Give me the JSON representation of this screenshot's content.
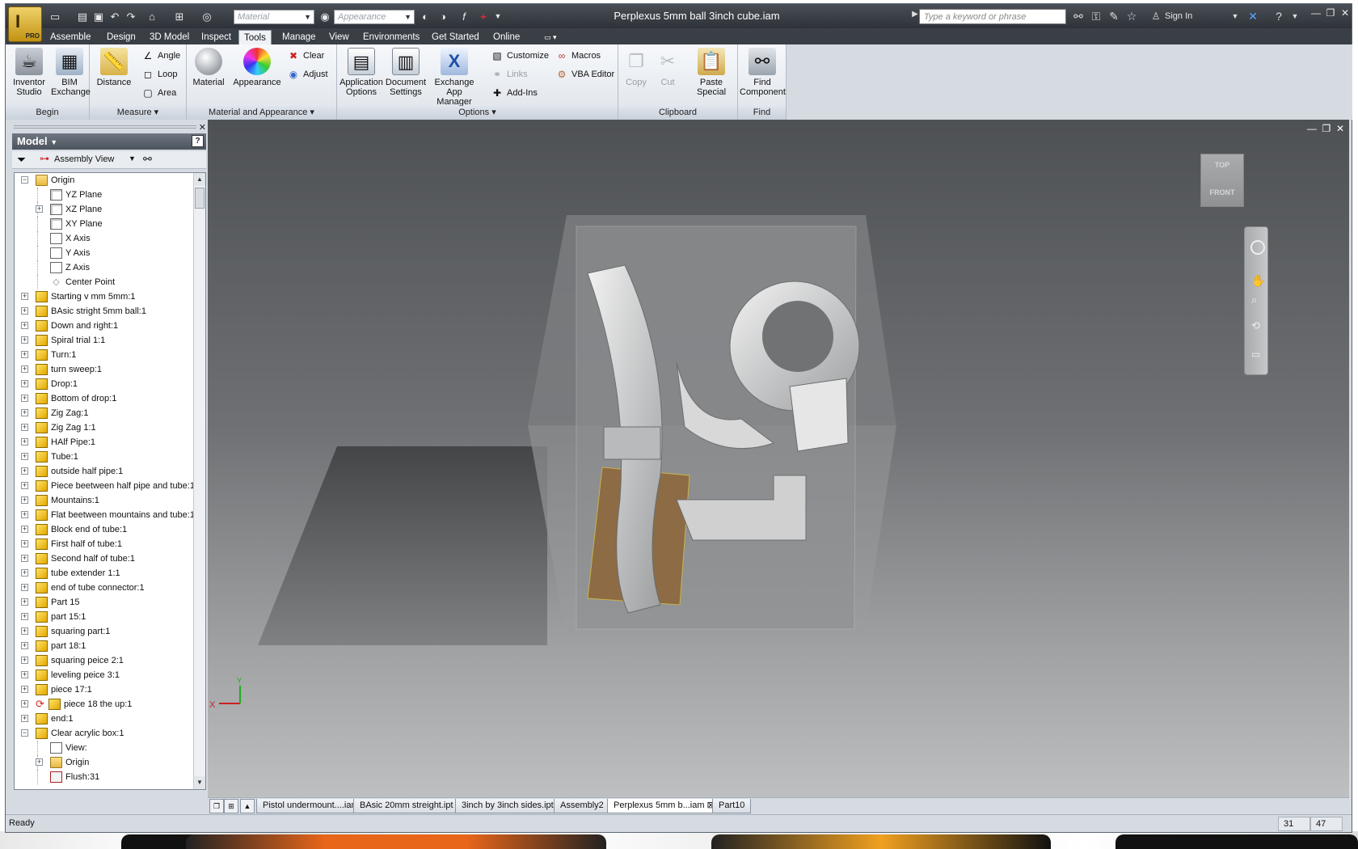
{
  "title_bar": {
    "title": "Perplexus 5mm ball 3inch cube.iam",
    "material_placeholder": "Material",
    "appearance_placeholder": "Appearance",
    "search_placeholder": "Type a keyword or phrase",
    "sign_in": "Sign In",
    "app_badge": "PRO",
    "app_logo_glyph": "I"
  },
  "tabs": [
    "Assemble",
    "Design",
    "3D Model",
    "Inspect",
    "Tools",
    "Manage",
    "View",
    "Environments",
    "Get Started",
    "Online"
  ],
  "active_tab": "Tools",
  "ribbon": {
    "begin": {
      "label": "Begin",
      "inventor_studio": "Inventor Studio",
      "bim_exchange": "BIM Exchange"
    },
    "measure": {
      "label": "Measure",
      "distance": "Distance",
      "angle": "Angle",
      "loop": "Loop",
      "area": "Area"
    },
    "material_appearance": {
      "label": "Material and Appearance",
      "material": "Material",
      "appearance": "Appearance",
      "clear": "Clear",
      "adjust": "Adjust"
    },
    "options": {
      "label": "Options",
      "application_options": "Application Options",
      "document_settings": "Document Settings",
      "exchange_app_manager": "Exchange App Manager",
      "customize": "Customize",
      "links": "Links",
      "add_ins": "Add-Ins",
      "macros": "Macros",
      "vba_editor": "VBA Editor"
    },
    "clipboard": {
      "label": "Clipboard",
      "copy": "Copy",
      "cut": "Cut",
      "paste_special": "Paste Special"
    },
    "find": {
      "label": "Find",
      "find_component": "Find Component"
    }
  },
  "browser": {
    "header": "Model",
    "view_mode": "Assembly View",
    "tree": [
      {
        "label": "Origin",
        "indent": 0,
        "icon": "folder-open-icon",
        "expander": "-"
      },
      {
        "label": "YZ Plane",
        "indent": 1,
        "icon": "plane-icon",
        "expander": ""
      },
      {
        "label": "XZ Plane",
        "indent": 1,
        "icon": "plane-icon",
        "expander": "+"
      },
      {
        "label": "XY Plane",
        "indent": 1,
        "icon": "plane-icon",
        "expander": ""
      },
      {
        "label": "X Axis",
        "indent": 1,
        "icon": "axis-icon",
        "expander": ""
      },
      {
        "label": "Y Axis",
        "indent": 1,
        "icon": "axis-icon",
        "expander": ""
      },
      {
        "label": "Z Axis",
        "indent": 1,
        "icon": "axis-icon",
        "expander": ""
      },
      {
        "label": "Center Point",
        "indent": 1,
        "icon": "point-icon",
        "expander": ""
      },
      {
        "label": "Starting v mm 5mm:1",
        "indent": 0,
        "icon": "part-icon",
        "expander": "+"
      },
      {
        "label": "BAsic stright 5mm ball:1",
        "indent": 0,
        "icon": "part-icon",
        "expander": "+"
      },
      {
        "label": "Down and right:1",
        "indent": 0,
        "icon": "part-icon",
        "expander": "+"
      },
      {
        "label": "Spiral trial 1:1",
        "indent": 0,
        "icon": "part-icon",
        "expander": "+"
      },
      {
        "label": "Turn:1",
        "indent": 0,
        "icon": "part-icon",
        "expander": "+"
      },
      {
        "label": "turn sweep:1",
        "indent": 0,
        "icon": "part-icon",
        "expander": "+"
      },
      {
        "label": "Drop:1",
        "indent": 0,
        "icon": "part-icon",
        "expander": "+"
      },
      {
        "label": "Bottom of drop:1",
        "indent": 0,
        "icon": "part-icon",
        "expander": "+"
      },
      {
        "label": "Zig Zag:1",
        "indent": 0,
        "icon": "part-icon",
        "expander": "+"
      },
      {
        "label": "Zig Zag 1:1",
        "indent": 0,
        "icon": "part-icon",
        "expander": "+"
      },
      {
        "label": "HAlf Pipe:1",
        "indent": 0,
        "icon": "part-icon",
        "expander": "+"
      },
      {
        "label": "Tube:1",
        "indent": 0,
        "icon": "part-icon",
        "expander": "+"
      },
      {
        "label": "outside half pipe:1",
        "indent": 0,
        "icon": "part-icon",
        "expander": "+"
      },
      {
        "label": "Piece beetween half pipe and tube:1",
        "indent": 0,
        "icon": "part-icon",
        "expander": "+"
      },
      {
        "label": "Mountains:1",
        "indent": 0,
        "icon": "part-icon",
        "expander": "+"
      },
      {
        "label": "Flat beetween mountains and tube:1",
        "indent": 0,
        "icon": "part-icon",
        "expander": "+"
      },
      {
        "label": "Block end of tube:1",
        "indent": 0,
        "icon": "part-icon",
        "expander": "+"
      },
      {
        "label": "First half of tube:1",
        "indent": 0,
        "icon": "part-icon",
        "expander": "+"
      },
      {
        "label": "Second half of tube:1",
        "indent": 0,
        "icon": "part-icon",
        "expander": "+"
      },
      {
        "label": "tube extender 1:1",
        "indent": 0,
        "icon": "part-icon",
        "expander": "+"
      },
      {
        "label": "end of tube connector:1",
        "indent": 0,
        "icon": "part-icon",
        "expander": "+"
      },
      {
        "label": "Part 15",
        "indent": 0,
        "icon": "part-icon",
        "expander": "+"
      },
      {
        "label": "part 15:1",
        "indent": 0,
        "icon": "part-icon",
        "expander": "+"
      },
      {
        "label": "squaring part:1",
        "indent": 0,
        "icon": "part-icon",
        "expander": "+"
      },
      {
        "label": "part 18:1",
        "indent": 0,
        "icon": "part-icon",
        "expander": "+"
      },
      {
        "label": "squaring peice 2:1",
        "indent": 0,
        "icon": "part-icon",
        "expander": "+"
      },
      {
        "label": "leveling peice 3:1",
        "indent": 0,
        "icon": "part-icon",
        "expander": "+"
      },
      {
        "label": "piece 17:1",
        "indent": 0,
        "icon": "part-icon",
        "expander": "+"
      },
      {
        "label": "piece 18 the up:1",
        "indent": 0,
        "icon": "part-icon",
        "expander": "+",
        "update_icon": true
      },
      {
        "label": "end:1",
        "indent": 0,
        "icon": "part-icon",
        "expander": "+"
      },
      {
        "label": "Clear acrylic box:1",
        "indent": 0,
        "icon": "part-icon",
        "expander": "-"
      },
      {
        "label": "View:",
        "indent": 1,
        "icon": "view-rep-icon",
        "expander": ""
      },
      {
        "label": "Origin",
        "indent": 1,
        "icon": "folder-icon",
        "expander": "+"
      },
      {
        "label": "Flush:31",
        "indent": 1,
        "icon": "constraint-icon",
        "expander": ""
      }
    ]
  },
  "viewcube": {
    "top": "TOP",
    "front": "FRONT"
  },
  "triad": {
    "x": "X",
    "y": "Y"
  },
  "doc_tabs": [
    "Pistol undermount....iam",
    "BAsic 20mm streight.ipt",
    "3inch by 3inch sides.ipt",
    "Assembly2",
    "Perplexus 5mm b...iam",
    "Part10"
  ],
  "active_doc_tab": "Perplexus 5mm b...iam",
  "status": {
    "text": "Ready",
    "num1": "31",
    "num2": "47"
  },
  "colors": {
    "title_bar": "#3a3f46",
    "ribbon": "#eef1f5",
    "viewport_top": "#4e5154",
    "viewport_bottom": "#bdbfc1",
    "part_icon": "#f2c21b"
  }
}
